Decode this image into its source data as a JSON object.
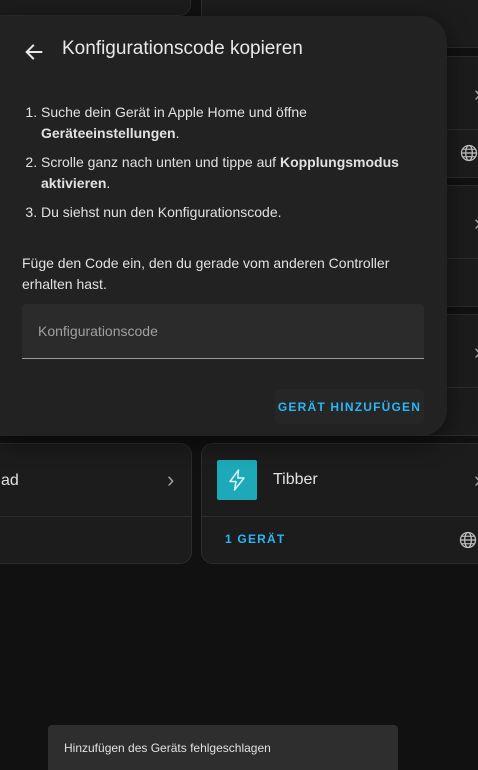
{
  "dialog": {
    "title": "Konfigurationscode kopieren",
    "steps": [
      {
        "text_a": "Suche dein Gerät in Apple Home und öffne ",
        "bold": "Geräteeinstellungen",
        "text_b": "."
      },
      {
        "text_a": "Scrolle ganz nach unten und tippe auf ",
        "bold": "Kopplungsmodus aktivieren",
        "text_b": "."
      },
      {
        "text_a": "Du siehst nun den Konfigurationscode.",
        "bold": "",
        "text_b": ""
      }
    ],
    "hint": "Füge den Code ein, den du gerade vom anderen Controller erhalten hast.",
    "input_placeholder": "Konfigurationscode",
    "input_value": "",
    "action_label": "GERÄT HINZUFÜGEN"
  },
  "cards": {
    "left_partial_title": "ad",
    "tibber": {
      "title": "Tibber",
      "devices_link": "1 GERÄT",
      "icon_color": "#1da9b8"
    }
  },
  "snackbar": {
    "message": "Hinzufügen des Geräts fehlgeschlagen"
  },
  "colors": {
    "background": "#111111",
    "dialog": "#222222",
    "accent": "#29b6f6"
  },
  "icons": {
    "back": "arrow-left-icon",
    "chevron": "chevron-right-icon",
    "globe": "globe-icon",
    "tibber": "lightning-icon"
  }
}
